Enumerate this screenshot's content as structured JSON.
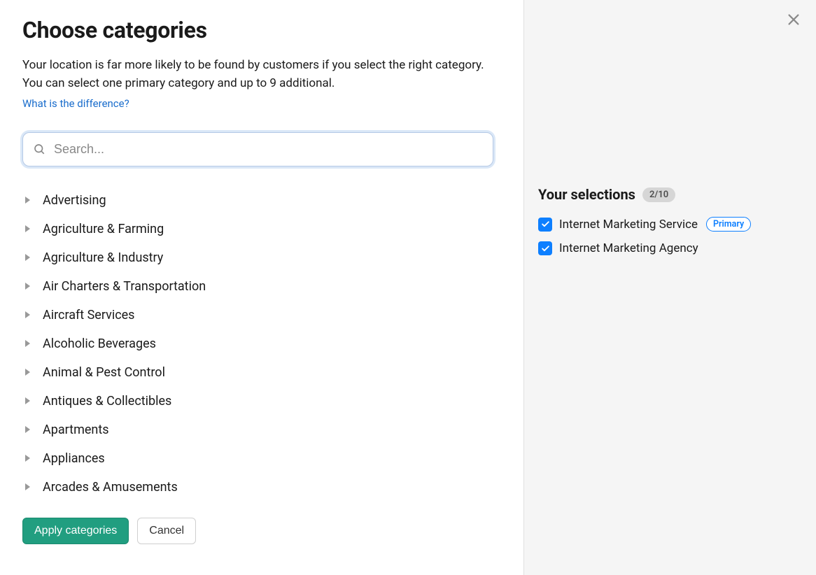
{
  "header": {
    "title": "Choose categories",
    "description": "Your location is far more likely to be found by customers if you select the right category. You can select one primary category and up to 9 additional.",
    "help_link": "What is the difference?"
  },
  "search": {
    "placeholder": "Search..."
  },
  "categories": [
    "Advertising",
    "Agriculture & Farming",
    "Agriculture & Industry",
    "Air Charters & Transportation",
    "Aircraft Services",
    "Alcoholic Beverages",
    "Animal & Pest Control",
    "Antiques & Collectibles",
    "Apartments",
    "Appliances",
    "Arcades & Amusements"
  ],
  "actions": {
    "apply": "Apply categories",
    "cancel": "Cancel"
  },
  "selections": {
    "title": "Your selections",
    "count": "2/10",
    "primary_label": "Primary",
    "items": [
      {
        "label": "Internet Marketing Service",
        "primary": true
      },
      {
        "label": "Internet Marketing Agency",
        "primary": false
      }
    ]
  }
}
